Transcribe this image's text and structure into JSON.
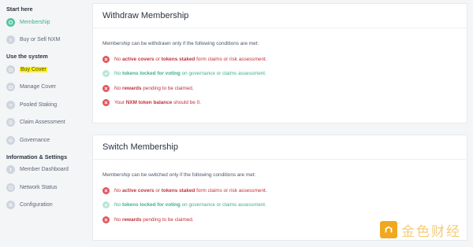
{
  "sidebar": {
    "sections": [
      {
        "title": "Start here",
        "items": [
          {
            "label": "Membership",
            "icon": "membership-icon",
            "active": true
          },
          {
            "label": "Buy or Sell NXM",
            "icon": "token-icon"
          }
        ]
      },
      {
        "title": "Use the system",
        "items": [
          {
            "label": "Buy Cover",
            "icon": "shopping-bag-icon",
            "highlighted": true
          },
          {
            "label": "Manage Cover",
            "icon": "briefcase-icon"
          },
          {
            "label": "Pooled Staking",
            "icon": "stack-icon"
          },
          {
            "label": "Claim Assessment",
            "icon": "document-icon"
          },
          {
            "label": "Governance",
            "icon": "globe-icon"
          }
        ]
      },
      {
        "title": "Information & Settings",
        "items": [
          {
            "label": "Member Dashboard",
            "icon": "dashboard-icon"
          },
          {
            "label": "Network Status",
            "icon": "network-icon"
          },
          {
            "label": "Configuration",
            "icon": "gear-icon"
          }
        ]
      }
    ]
  },
  "withdraw": {
    "title": "Withdraw Membership",
    "intro": "Membership can be withdrawn only if the following conditions are met:",
    "conditions": [
      {
        "status": "bad",
        "parts": [
          "No ",
          "active covers",
          " or ",
          "tokens staked",
          " form claims or risk assessment."
        ]
      },
      {
        "status": "ok",
        "parts": [
          "No ",
          "tokens locked for voting",
          " on governance or claims assessment."
        ]
      },
      {
        "status": "bad",
        "parts": [
          "No ",
          "rewards",
          " pending to be claimed."
        ]
      },
      {
        "status": "bad",
        "parts": [
          "Your ",
          "NXM token balance",
          " should be 0."
        ]
      }
    ]
  },
  "switch": {
    "title": "Switch Membership",
    "intro": "Membership can be switched only if the following conditions are met:",
    "conditions": [
      {
        "status": "bad",
        "parts": [
          "No ",
          "active covers",
          " or ",
          "tokens staked",
          " form claims or risk assessment."
        ]
      },
      {
        "status": "ok",
        "parts": [
          "No ",
          "tokens locked for voting",
          " on governance or claims assessment."
        ]
      },
      {
        "status": "bad",
        "parts": [
          "No ",
          "rewards",
          " pending to be claimed."
        ]
      }
    ]
  },
  "watermark": {
    "text": "金色财经"
  },
  "colors": {
    "active": "#3fb08c",
    "error": "#c0323a",
    "highlight": "#fff200"
  }
}
